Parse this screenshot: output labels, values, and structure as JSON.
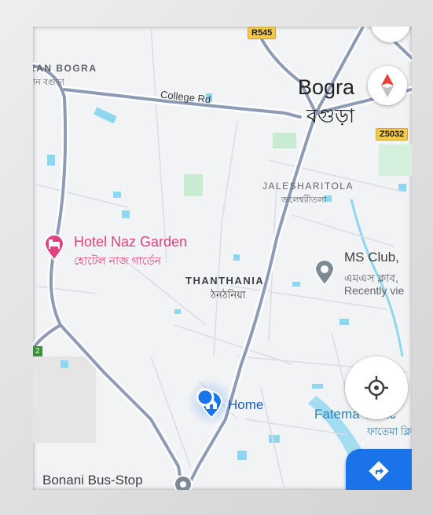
{
  "map": {
    "highways": [
      {
        "label": "R545"
      },
      {
        "label": "Z5032"
      },
      {
        "label": "2"
      }
    ],
    "roads": [
      {
        "label": "College Rd"
      }
    ],
    "areas": [
      {
        "name_en": "RAN BOGRA",
        "name_bn": "রান বগুড়া"
      },
      {
        "name_en": "JALESHARITOLA",
        "name_bn": "জলেশ্বরীতলা"
      },
      {
        "name_en": "THANTHANIA",
        "name_bn": "ঠনঠনিয়া"
      }
    ],
    "city": {
      "name_en": "Bogra",
      "name_bn": "বগুড়া"
    },
    "places": [
      {
        "name_en": "Hotel Naz Garden",
        "name_bn": "হোটেল নাজ গার্ডেন",
        "icon": "hotel-bed-icon",
        "color": "#e0417f"
      },
      {
        "name_en": "MS Club,",
        "name_bn": "এমএস ক্লাব,",
        "note": "Recently vie",
        "icon": "place-pin-icon"
      },
      {
        "name_en": "Fatema Clinic",
        "name_bn": "ফাতেমা ক্লি",
        "icon": "clinic-icon"
      },
      {
        "name_en": "Bonani Bus-Stop",
        "icon": "bus-stop-icon"
      }
    ],
    "home": {
      "label": "Home",
      "icon": "home-icon"
    },
    "colors": {
      "road": "#8e9bb5",
      "road_casing": "#ffffff",
      "water": "#8fd7f0",
      "park": "#c7ecd1",
      "location_blue": "#1a73e8"
    }
  },
  "controls": {
    "compass": "compass-icon",
    "my_location": "my-location-icon",
    "directions": "directions-icon"
  }
}
